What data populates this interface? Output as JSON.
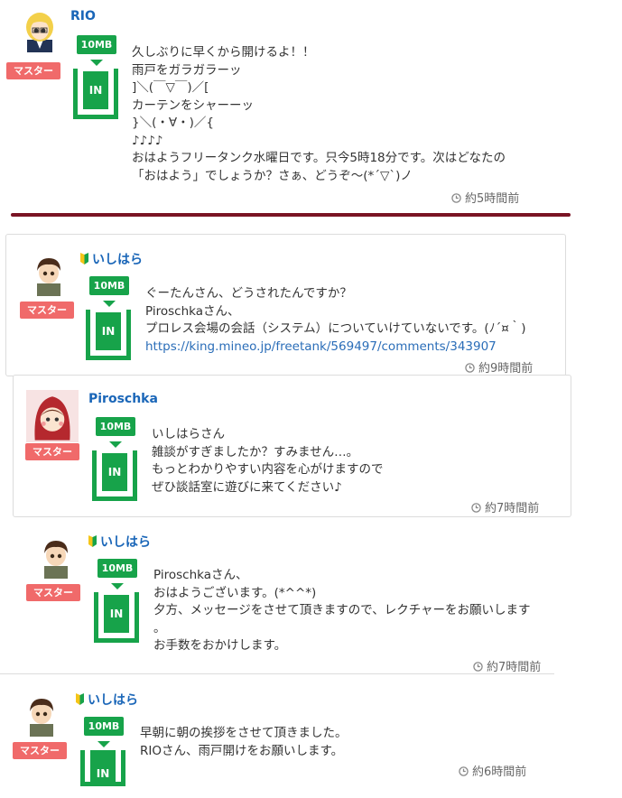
{
  "badge_master": "マスター",
  "capacity": {
    "amount": "10MB",
    "direction": "IN"
  },
  "posts": [
    {
      "username": "RIO",
      "lines": [
        "久しぶりに早くから開けるよ！！",
        "雨戸をガラガラーッ",
        "]＼(￣▽￣)／[",
        "カーテンをシャーーッ",
        "}＼(・∀・)／{",
        "♪♪♪♪",
        "おはようフリータンク水曜日です。只今5時18分です。次はどなたの",
        "「おはよう」でしょうか？さぁ、どうぞ～(*´▽`)ノ"
      ],
      "time": "約5時間前"
    },
    {
      "username": "いしはら",
      "lines": [
        "ぐーたんさん、どうされたんですか？",
        "Piroschkaさん、",
        "プロレス会場の会話（システム）についていけていないです。(ﾉ´¤｀)"
      ],
      "link": "https://king.mineo.jp/freetank/569497/comments/343907",
      "time": "約9時間前"
    },
    {
      "username": "Piroschka",
      "lines": [
        "いしはらさん",
        "雑談がすぎましたか？すみません…。",
        "もっとわかりやすい内容を心がけますので",
        "ぜひ談話室に遊びに来てください♪"
      ],
      "time": "約7時間前"
    },
    {
      "username": "いしはら",
      "lines": [
        "Piroschkaさん、",
        "おはようございます。(*^^*)",
        "夕方、メッセージをさせて頂きますので、レクチャーをお願いします",
        "。",
        "お手数をおかけします。"
      ],
      "time": "約7時間前"
    },
    {
      "username": "いしはら",
      "lines": [
        "早朝に朝の挨拶をさせて頂きました。",
        "RIOさん、雨戸開けをお願いします。"
      ],
      "time": "約6時間前"
    }
  ]
}
